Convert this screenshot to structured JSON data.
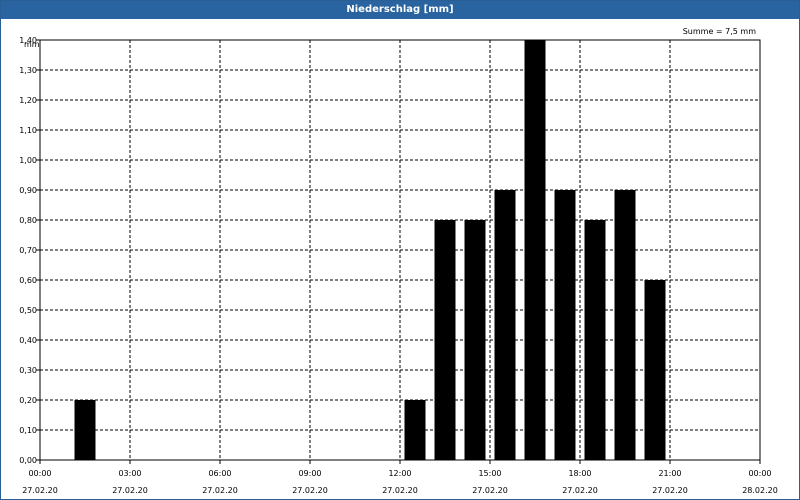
{
  "window": {
    "title": "Niederschlag [mm]"
  },
  "summary": "Summe = 7,5 mm",
  "chart_data": {
    "type": "bar",
    "title": "Niederschlag [mm]",
    "ylabel": "mm",
    "xlabel": "",
    "ylim": [
      0,
      1.4
    ],
    "grid": true,
    "bar_color": "#000000",
    "header_color": "#2a64a0",
    "y_ticks": [
      {
        "value": 0.0,
        "label": "0,00"
      },
      {
        "value": 0.1,
        "label": "0,10"
      },
      {
        "value": 0.2,
        "label": "0,20"
      },
      {
        "value": 0.3,
        "label": "0,30"
      },
      {
        "value": 0.4,
        "label": "0,40"
      },
      {
        "value": 0.5,
        "label": "0,50"
      },
      {
        "value": 0.6,
        "label": "0,60"
      },
      {
        "value": 0.7,
        "label": "0,70"
      },
      {
        "value": 0.8,
        "label": "0,80"
      },
      {
        "value": 0.9,
        "label": "0,90"
      },
      {
        "value": 1.0,
        "label": "1,00"
      },
      {
        "value": 1.1,
        "label": "1,10"
      },
      {
        "value": 1.2,
        "label": "1,20"
      },
      {
        "value": 1.3,
        "label": "1,30"
      },
      {
        "value": 1.4,
        "label": "1,40"
      }
    ],
    "x_ticks": [
      {
        "hours": 0,
        "time": "00:00",
        "date": "27.02.20"
      },
      {
        "hours": 3,
        "time": "03:00",
        "date": "27.02.20"
      },
      {
        "hours": 6,
        "time": "06:00",
        "date": "27.02.20"
      },
      {
        "hours": 9,
        "time": "09:00",
        "date": "27.02.20"
      },
      {
        "hours": 12,
        "time": "12:00",
        "date": "27.02.20"
      },
      {
        "hours": 15,
        "time": "15:00",
        "date": "27.02.20"
      },
      {
        "hours": 18,
        "time": "18:00",
        "date": "27.02.20"
      },
      {
        "hours": 21,
        "time": "21:00",
        "date": "27.02.20"
      },
      {
        "hours": 24,
        "time": "00:00",
        "date": "28.02.20"
      }
    ],
    "x_range_hours": [
      0,
      24
    ],
    "bars": [
      {
        "hour": 1,
        "value": 0.2
      },
      {
        "hour": 12,
        "value": 0.2
      },
      {
        "hour": 13,
        "value": 0.8
      },
      {
        "hour": 14,
        "value": 0.8
      },
      {
        "hour": 15,
        "value": 0.9
      },
      {
        "hour": 16,
        "value": 1.4
      },
      {
        "hour": 17,
        "value": 0.9
      },
      {
        "hour": 18,
        "value": 0.8
      },
      {
        "hour": 19,
        "value": 0.9
      },
      {
        "hour": 20,
        "value": 0.6
      }
    ]
  }
}
